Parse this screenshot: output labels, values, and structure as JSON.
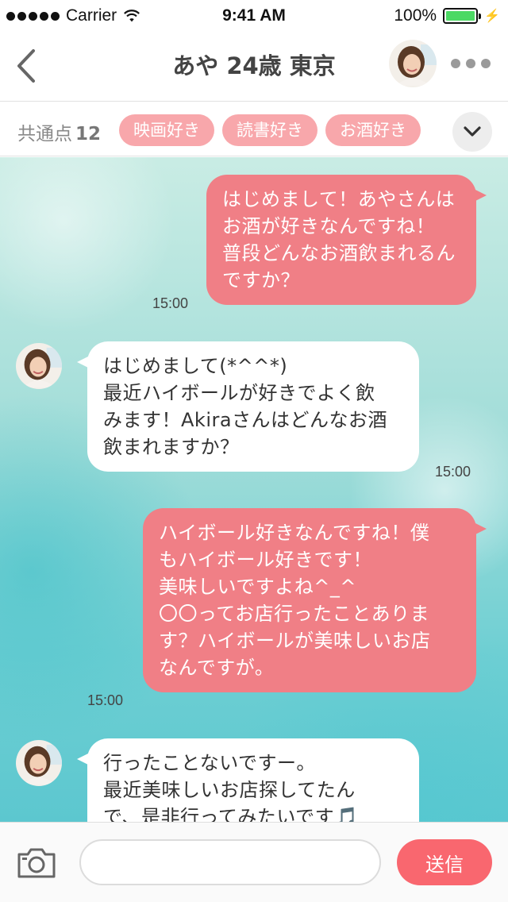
{
  "status_bar": {
    "carrier": "Carrier",
    "time": "9:41 AM",
    "battery": "100%",
    "battery_level": 1.0
  },
  "nav": {
    "title": "あや 24歳 東京",
    "back_icon": "chevron-left-icon",
    "more_icon": "more-dots-icon"
  },
  "common": {
    "label": "共通点",
    "count": "12",
    "tags": [
      "映画好き",
      "読書好き",
      "お酒好き"
    ],
    "expand_icon": "chevron-down-icon"
  },
  "messages": [
    {
      "direction": "out",
      "lines": [
        "はじめまして！あやさんは",
        "お酒が好きなんですね！",
        "普段どんなお酒飲まれるん",
        "ですか？"
      ],
      "time": "15:00"
    },
    {
      "direction": "in",
      "lines": [
        "はじめまして(*^^*)",
        "最近ハイボールが好きでよく飲",
        "みます！Akiraさんはどんなお酒",
        "飲まれますか？"
      ],
      "time": "15:00"
    },
    {
      "direction": "out",
      "lines": [
        "ハイボール好きなんですね！僕",
        "もハイボール好きです！",
        "美味しいですよね^_^",
        "〇〇ってお店行ったことありま",
        "す？ハイボールが美味しいお店",
        "なんですが。"
      ],
      "time": "15:00"
    },
    {
      "direction": "in",
      "lines": [
        "行ったことないですー。",
        "最近美味しいお店探してたん",
        "で、是非行ってみたいです🎵"
      ],
      "time": ""
    }
  ],
  "input": {
    "placeholder": "",
    "value": "",
    "send_label": "送信",
    "camera_icon": "camera-icon"
  },
  "colors": {
    "accent": "#f9676f",
    "outgoing_bubble": "#f07f86",
    "tag": "#f8a7ab"
  }
}
